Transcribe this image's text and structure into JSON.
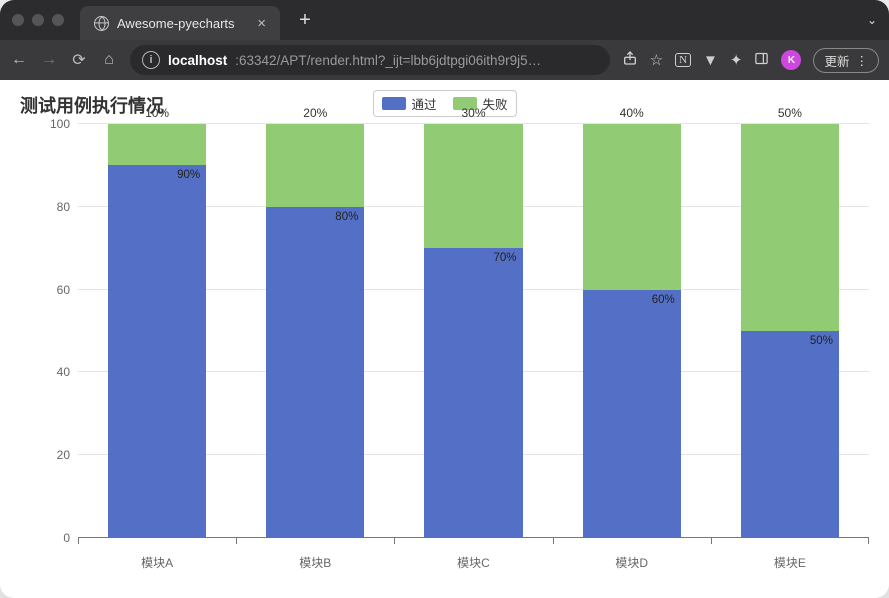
{
  "window": {
    "tab_title": "Awesome-pyecharts"
  },
  "toolbar": {
    "host": "localhost",
    "port_path": ":63342/APT/render.html?_ijt=lbb6jdtpgi06ith9r9j5…",
    "update_label": "更新",
    "avatar_letter": "K"
  },
  "chart_data": {
    "type": "bar",
    "stacked": true,
    "title": "测试用例执行情况",
    "categories": [
      "模块A",
      "模块B",
      "模块C",
      "模块D",
      "模块E"
    ],
    "series": [
      {
        "name": "通过",
        "color": "#5470c6",
        "values": [
          90,
          80,
          70,
          60,
          50
        ]
      },
      {
        "name": "失败",
        "color": "#91cc75",
        "values": [
          10,
          20,
          30,
          40,
          50
        ]
      }
    ],
    "value_labels_pass": [
      "90%",
      "80%",
      "70%",
      "60%",
      "50%"
    ],
    "value_labels_fail": [
      "10%",
      "20%",
      "30%",
      "40%",
      "50%"
    ],
    "ylabel": "",
    "xlabel": "",
    "ylim": [
      0,
      100
    ],
    "y_ticks": [
      0,
      20,
      40,
      60,
      80,
      100
    ]
  }
}
